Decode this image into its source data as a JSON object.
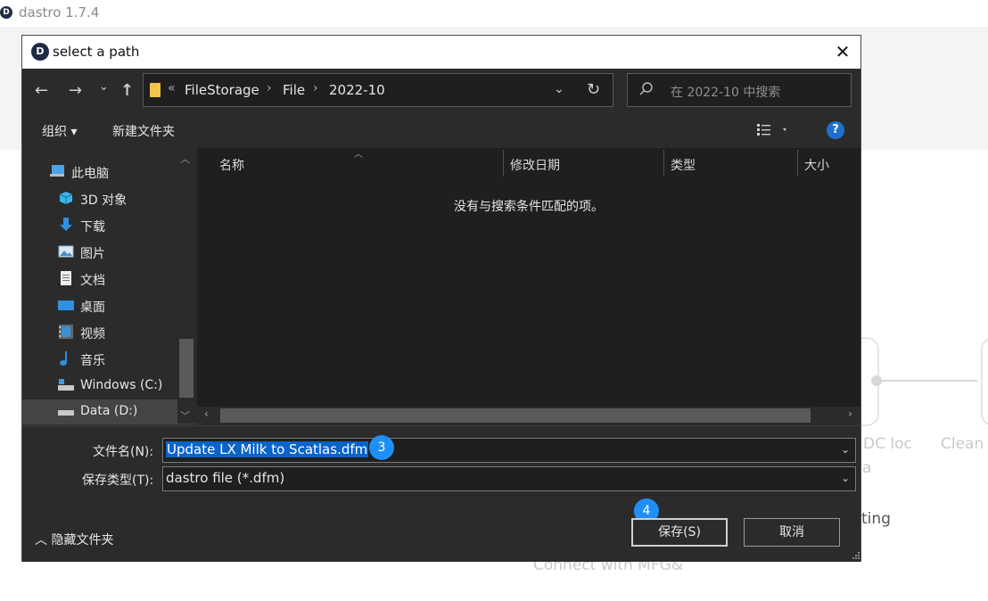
{
  "app": {
    "title": "dastro 1.7.4",
    "bg_texts": [
      "DC loc",
      "a",
      "Clean",
      "ting",
      "Connect with MFG&"
    ]
  },
  "dialog": {
    "title": "select a path",
    "nav": {
      "back": "←",
      "forward": "→",
      "recent": "⌄",
      "up": "↑"
    },
    "address": {
      "overflow": "«",
      "segments": [
        "FileStorage",
        "File",
        "2022-10"
      ]
    },
    "search": {
      "placeholder": "在 2022-10 中搜索"
    },
    "toolbar": {
      "organize": "组织 ▾",
      "new_folder": "新建文件夹"
    },
    "sidebar": {
      "items": [
        {
          "label": "此电脑",
          "icon": "computer-icon"
        },
        {
          "label": "3D 对象",
          "icon": "cube-icon"
        },
        {
          "label": "下载",
          "icon": "download-icon"
        },
        {
          "label": "图片",
          "icon": "pictures-icon"
        },
        {
          "label": "文档",
          "icon": "documents-icon"
        },
        {
          "label": "桌面",
          "icon": "desktop-icon"
        },
        {
          "label": "视频",
          "icon": "video-icon"
        },
        {
          "label": "音乐",
          "icon": "music-icon"
        },
        {
          "label": "Windows (C:)",
          "icon": "drive-icon"
        },
        {
          "label": "Data (D:)",
          "icon": "drive-icon"
        }
      ]
    },
    "columns": [
      "名称",
      "修改日期",
      "类型",
      "大小"
    ],
    "empty_message": "没有与搜索条件匹配的项。",
    "filename": {
      "label": "文件名(N):",
      "value": "Update LX Milk to Scatlas.dfm"
    },
    "filetype": {
      "label": "保存类型(T):",
      "value": "dastro file (*.dfm)"
    },
    "hide_folders": "隐藏文件夹",
    "save_button": "保存(S)",
    "cancel_button": "取消",
    "badges": [
      "3",
      "4"
    ]
  },
  "colors": {
    "dialog_bg": "#2b2b2b",
    "list_bg": "#1f1f1f",
    "selection": "#0a64c8",
    "badge": "#1f8ff5",
    "help": "#1f6fd0"
  }
}
